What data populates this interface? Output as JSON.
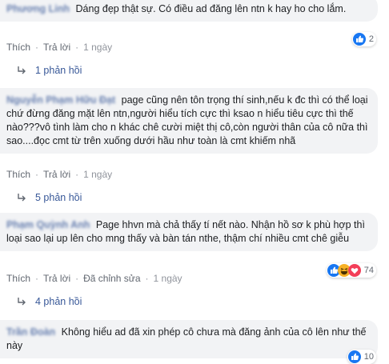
{
  "comments": [
    {
      "author": "Phương Linh",
      "text": "Dáng đẹp thật sự. Có điều ad đăng lên ntn k hay ho cho lắm.",
      "actions": {
        "like": "Thích",
        "reply": "Trả lời",
        "time": "1 ngày"
      },
      "reaction_count": "2",
      "reactions": [
        "like-icon"
      ],
      "replies_label": "1 phản hồi"
    },
    {
      "author": "Nguyễn Phạm Hữu Đạt",
      "text": "page cũng nên tôn trọng thí sinh,nếu k đc thì có thể loại chứ đừng đăng mặt lên ntn,người hiểu tích cực thì ksao n hiểu tiêu cực thì thế nào???vô tình làm cho n khác chê cười miệt thị cô,còn người thân của cô nữa thì sao....đọc cmt từ trên xuống dưới hầu như toàn là cmt khiếm nhã",
      "actions": {
        "like": "Thích",
        "reply": "Trả lời",
        "time": "1 ngày"
      },
      "replies_label": "5 phản hồi"
    },
    {
      "author": "Phạm Quỳnh Anh",
      "text": "Page hhvn mà chả thấy tí nết nào. Nhận hồ sơ k phù hợp thì loại sao lại up lên cho mng thấy và bàn tán nthe, thậm chí nhiều cmt chê giễu",
      "actions": {
        "like": "Thích",
        "reply": "Trả lời",
        "extra": "Đã chỉnh sửa",
        "time": "1 ngày"
      },
      "reaction_count": "74",
      "reactions": [
        "like-icon",
        "haha-icon",
        "love-icon"
      ],
      "replies_label": "4 phản hồi"
    },
    {
      "author": "Trần Đoàn",
      "text": "Không hiểu ad đã xin phép cô chưa mà đăng ảnh của cô lên như thế này",
      "reaction_count": "10",
      "reactions": [
        "like-icon"
      ]
    }
  ],
  "colors": {
    "bubble": "#f2f3f5",
    "link": "#385898",
    "meta": "#616770",
    "like_blue": "#1877f2",
    "love_red": "#f33e58",
    "haha_yellow": "#f7b125"
  }
}
